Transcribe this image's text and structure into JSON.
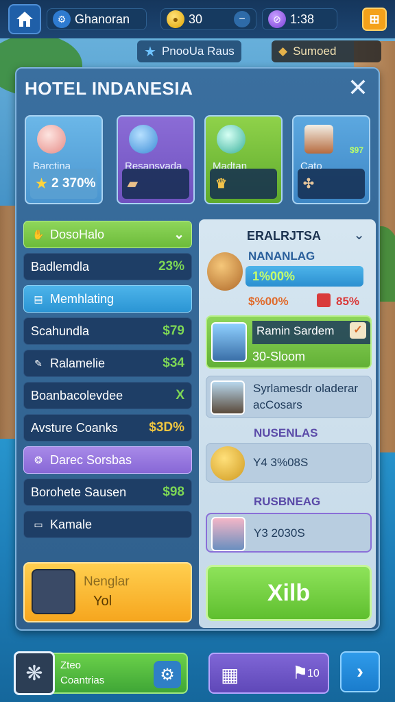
{
  "topbar": {
    "username": "Ghanoran",
    "coins": "30",
    "timer": "1:38"
  },
  "subbar": {
    "left": "PnooUa Raus",
    "right": "Sumoed"
  },
  "panel": {
    "title": "HOTEL INDANESIA",
    "close": "✕"
  },
  "cards": [
    {
      "label": "Barctina",
      "value": "2 370%"
    },
    {
      "label": "Resansvada",
      "value": ""
    },
    {
      "label": "Madtan",
      "value": ""
    },
    {
      "label": "Cato",
      "value": "",
      "extra": "$97"
    }
  ],
  "list": [
    {
      "label": "DosoHalo",
      "value": "",
      "style": "green"
    },
    {
      "label": "Badlemdla",
      "value": "23%"
    },
    {
      "label": "Memhlating",
      "value": "",
      "style": "blue"
    },
    {
      "label": "Scahundla",
      "value": "$79"
    },
    {
      "label": "Ralamelie",
      "value": "$34"
    },
    {
      "label": "Boanbacolevdee",
      "value": "X"
    },
    {
      "label": "Avsture Coanks",
      "value": "$3D%",
      "style": "gold"
    },
    {
      "label": "Darec Sorsbas",
      "value": "",
      "style": "purple"
    },
    {
      "label": "Borohete Sausen",
      "value": "$98"
    },
    {
      "label": "Kamale",
      "value": ""
    }
  ],
  "orange_button": {
    "line1": "Nenglar",
    "line2": "Yol"
  },
  "right": {
    "header": "ERALRJTSA",
    "s1_label": "NANANLAG",
    "s1_bar": "1%00%",
    "s1_left": "$%00%",
    "s1_right": "85%",
    "green_title": "Ramin Sardem",
    "green_sub": "30-Sloom",
    "grey1": "Syrlamesdr oladerar acCosars",
    "s2_label": "NUSENLAS",
    "grey2": "Y4 3%08S",
    "s3_label": "RUSBNEAG",
    "grey3": "Y3 2030S",
    "big_button": "Xilb"
  },
  "bottom": {
    "t1": "Zteo",
    "t2": "Coantrias",
    "count": "10"
  },
  "colors": {
    "accent_green": "#7dd655",
    "panel_blue": "#2f5f8c",
    "gold": "#f6a61e"
  }
}
